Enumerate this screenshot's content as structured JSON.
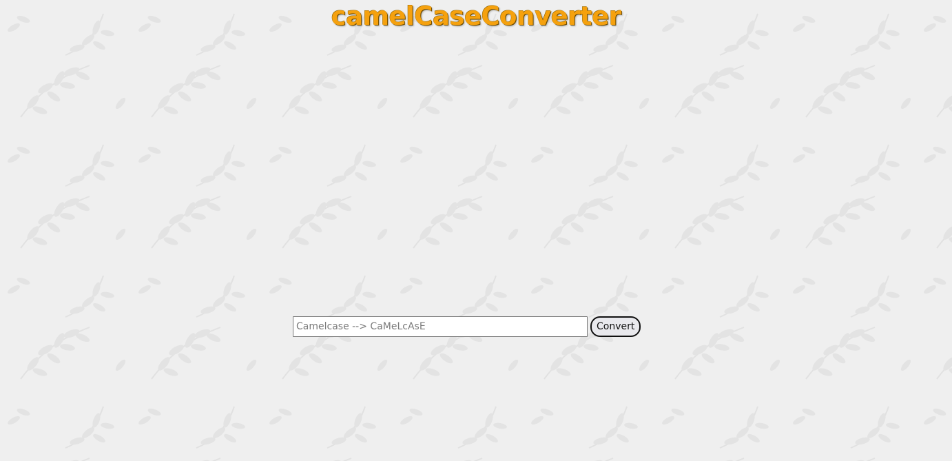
{
  "page": {
    "title": "camelCaseConverter",
    "title_color": "#f5a10e",
    "background_color": "#efefef"
  },
  "converter": {
    "input_placeholder": "Camelcase --> CaMeLcAsE",
    "input_value": "",
    "convert_label": "Convert"
  },
  "icons": {
    "background": "leaf-pattern-icon"
  }
}
